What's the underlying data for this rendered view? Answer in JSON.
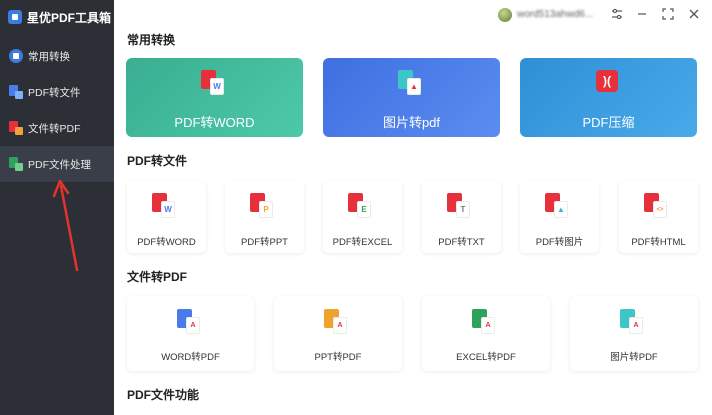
{
  "app": {
    "title": "星优PDF工具箱"
  },
  "sidebar": {
    "items": [
      {
        "label": "常用转换",
        "icon": "grid-icon",
        "active": false
      },
      {
        "label": "PDF转文件",
        "icon": "pdf-to-file-icon",
        "active": false
      },
      {
        "label": "文件转PDF",
        "icon": "file-to-pdf-icon",
        "active": false
      },
      {
        "label": "PDF文件处理",
        "icon": "pdf-process-icon",
        "active": true
      }
    ]
  },
  "topbar": {
    "username": "word513ahwd6...",
    "controls": [
      "settings-icon",
      "minimize-icon",
      "maximize-icon",
      "close-icon"
    ]
  },
  "sections": {
    "common": {
      "title": "常用转换",
      "cards": [
        {
          "label": "PDF转WORD",
          "color": "#3db89a",
          "icon": "pdf-to-word-icon"
        },
        {
          "label": "图片转pdf",
          "color": "#4a7bea",
          "icon": "image-to-pdf-icon"
        },
        {
          "label": "PDF压缩",
          "color": "#3b9ce0",
          "icon": "pdf-compress-icon"
        }
      ]
    },
    "pdf_to_file": {
      "title": "PDF转文件",
      "tiles": [
        {
          "label": "PDF转WORD",
          "glyph": "W",
          "color": "#4a7bea"
        },
        {
          "label": "PDF转PPT",
          "glyph": "P",
          "color": "#f0a32a"
        },
        {
          "label": "PDF转EXCEL",
          "glyph": "E",
          "color": "#2ea15a"
        },
        {
          "label": "PDF转TXT",
          "glyph": "T",
          "color": "#7a7a7a"
        },
        {
          "label": "PDF转图片",
          "glyph": "▲",
          "color": "#3cb8c8"
        },
        {
          "label": "PDF转HTML",
          "glyph": "<>",
          "color": "#e89a3c"
        }
      ]
    },
    "file_to_pdf": {
      "title": "文件转PDF",
      "tiles": [
        {
          "label": "WORD转PDF",
          "glyph": "W",
          "color": "#4a7bea"
        },
        {
          "label": "PPT转PDF",
          "glyph": "P",
          "color": "#f0a32a"
        },
        {
          "label": "EXCEL转PDF",
          "glyph": "E",
          "color": "#2ea15a"
        },
        {
          "label": "图片转PDF",
          "glyph": "▲",
          "color": "#3cb8c8"
        }
      ]
    },
    "pdf_functions": {
      "title": "PDF文件功能"
    }
  },
  "colors": {
    "sidebar": "#2c2f36",
    "pdf_red": "#e6313d",
    "accent": "#3f7ae0",
    "annotation_arrow": "#e5322d"
  }
}
